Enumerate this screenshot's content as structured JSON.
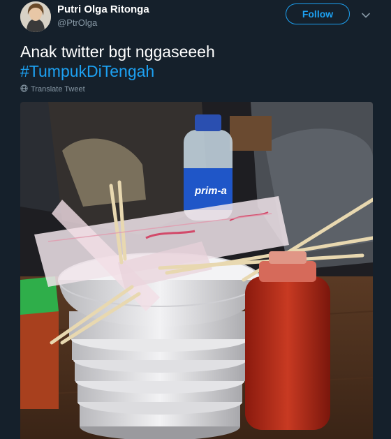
{
  "author": {
    "display_name": "Putri Olga Ritonga",
    "handle": "@PtrOlga"
  },
  "header": {
    "follow_label": "Follow"
  },
  "tweet": {
    "text": "Anak twitter bgt nggaseeeh",
    "hashtag": "#TumpukDiTengah",
    "translate_label": "Translate Tweet"
  },
  "photo": {
    "bottle_label": "prim-a"
  },
  "colors": {
    "background": "#15202b",
    "accent": "#1da1f2",
    "muted": "#8899a6"
  },
  "icons": {
    "more": "chevron-down-icon",
    "translate": "globe-icon"
  }
}
